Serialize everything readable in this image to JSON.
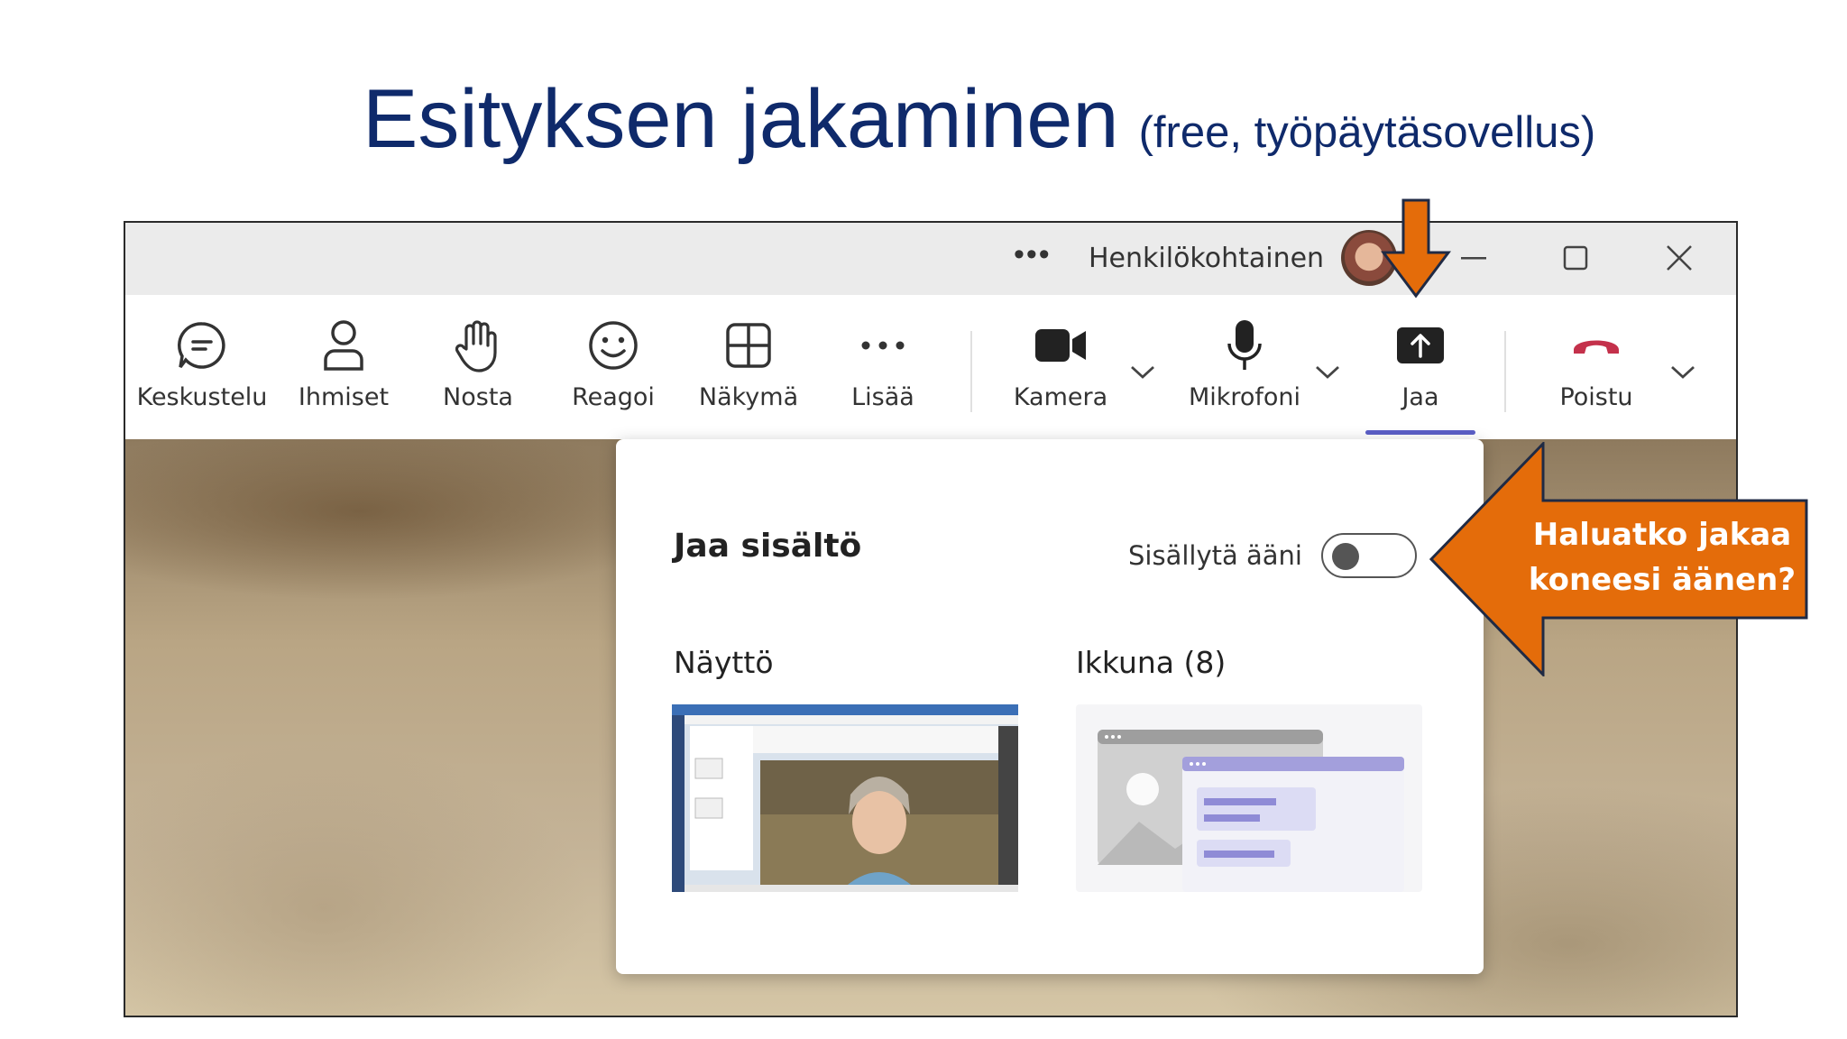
{
  "slide": {
    "title": "Esityksen jakaminen",
    "subtitle": "(free, työpäytäsovellus)"
  },
  "titlebar": {
    "more": "•••",
    "profile": "Henkilökohtainen"
  },
  "toolbar": {
    "items": [
      {
        "label": "Keskustelu",
        "icon": "chat-icon"
      },
      {
        "label": "Ihmiset",
        "icon": "people-icon"
      },
      {
        "label": "Nosta",
        "icon": "raise-hand-icon"
      },
      {
        "label": "Reagoi",
        "icon": "smiley-icon"
      },
      {
        "label": "Näkymä",
        "icon": "view-grid-icon"
      },
      {
        "label": "Lisää",
        "icon": "more-icon"
      },
      {
        "label": "Kamera",
        "icon": "camera-icon"
      },
      {
        "label": "Mikrofoni",
        "icon": "microphone-icon"
      },
      {
        "label": "Jaa",
        "icon": "share-icon"
      },
      {
        "label": "Poistu",
        "icon": "hang-up-icon"
      }
    ]
  },
  "share_panel": {
    "title": "Jaa sisältö",
    "include_audio_label": "Sisällytä ääni",
    "include_audio_on": false,
    "screen_label": "Näyttö",
    "window_label": "Ikkuna (8)"
  },
  "callout": {
    "line1": "Haluatko jakaa",
    "line2": "koneesi äänen?"
  },
  "colors": {
    "title": "#0f2a6b",
    "accent": "#5b5fc7",
    "callout_fill": "#e46c0a",
    "hangup": "#c4314b"
  }
}
